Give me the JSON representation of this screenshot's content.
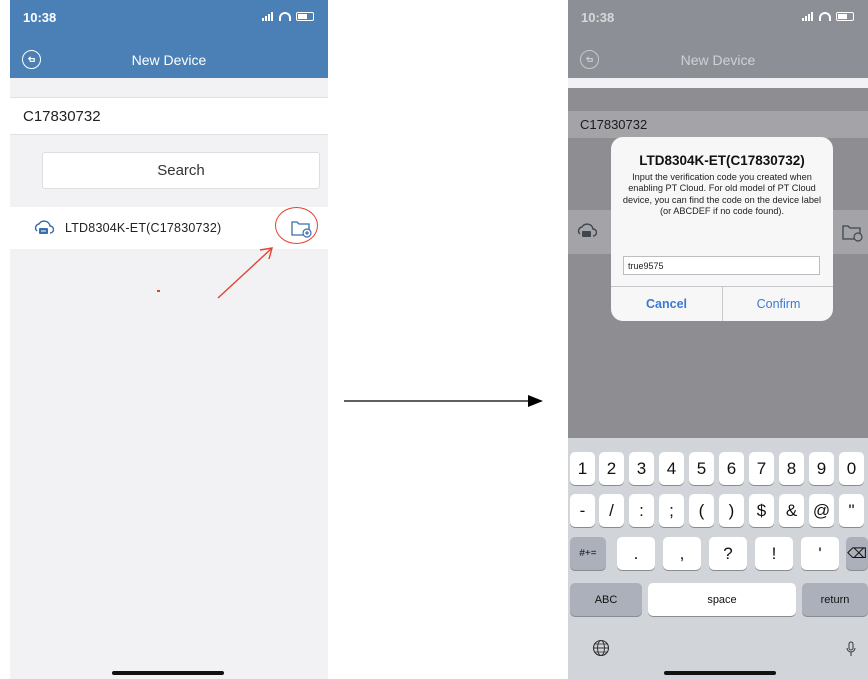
{
  "left": {
    "status_time": "10:38",
    "title": "New Device",
    "device_id_value": "C17830732",
    "search_label": "Search",
    "device_name": "LTD8304K-ET(C17830732)"
  },
  "right": {
    "status_time": "10:38",
    "title": "New Device",
    "device_id_value": "C17830732",
    "dialog": {
      "title": "LTD8304K-ET(C17830732)",
      "message": "Input the verification code you created when enabling PT Cloud. For old model of PT Cloud device, you can find the code on the device label (or ABCDEF if no code found).",
      "input_value": "true9575",
      "cancel_label": "Cancel",
      "confirm_label": "Confirm"
    },
    "keyboard": {
      "row1": [
        "1",
        "2",
        "3",
        "4",
        "5",
        "6",
        "7",
        "8",
        "9",
        "0"
      ],
      "row2": [
        "-",
        "/",
        ":",
        ";",
        "(",
        ")",
        "$",
        "&",
        "@",
        "\""
      ],
      "row3_mode": "#+=",
      "row3": [
        ".",
        ",",
        "?",
        "!",
        "'"
      ],
      "backspace": "⌫",
      "abc": "ABC",
      "space": "space",
      "return": "return"
    }
  },
  "colors": {
    "app_bar": "#4a80b5",
    "accent_red": "#e24333",
    "button_blue": "#3b79d4"
  },
  "icons": {
    "back": "back-icon",
    "cloud_device": "cloud-device-icon",
    "add_device": "add-device-icon",
    "globe": "globe-icon",
    "mic": "mic-icon"
  }
}
